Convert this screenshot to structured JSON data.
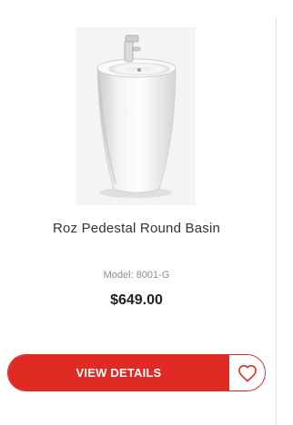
{
  "product": {
    "name": "Roz Pedestal Round Basin",
    "model": "Model: 8001-G",
    "price": "$649.00",
    "image_icon": "pedestal-basin-image"
  },
  "actions": {
    "view_details_label": "VIEW DETAILS",
    "wishlist_icon": "heart-icon"
  },
  "colors": {
    "accent": "#e02a24",
    "price_text": "#222222",
    "model_text": "#8c8c8c"
  }
}
